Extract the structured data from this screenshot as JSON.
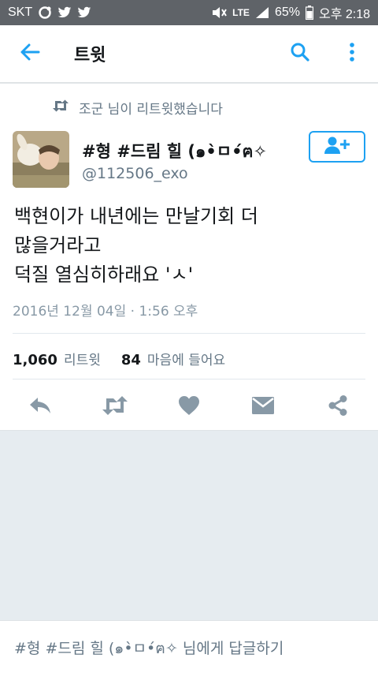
{
  "status_bar": {
    "carrier": "SKT",
    "network": "LTE",
    "battery": "65%",
    "time": "오후 2:18",
    "icons": [
      "target-icon",
      "twitter-bird-icon",
      "twitter-bird-icon",
      "mute-icon",
      "signal-icon",
      "battery-icon"
    ]
  },
  "app_bar": {
    "title": "트윗",
    "icons": [
      "back-arrow-icon",
      "search-icon",
      "more-vertical-icon"
    ]
  },
  "tweet": {
    "retweet_context": "조군 님이 리트윗했습니다",
    "author_name": "#형 #드림 힐 (๑•̀ㅁ•́ฅ✧",
    "author_handle": "@112506_exo",
    "text": "백현이가 내년에는 만날기회 더\n많을거라고\n덕질 열심히하래요 'ㅅ'",
    "timestamp": "2016년 12월 04일 · 1:56 오후",
    "retweets_count": "1,060",
    "retweets_label": "리트윗",
    "likes_count": "84",
    "likes_label": "마음에 들어요",
    "follow_icon": "add-user-icon",
    "action_icons": [
      "reply-icon",
      "retweet-icon",
      "like-heart-icon",
      "message-icon",
      "share-icon"
    ]
  },
  "reply_bar": {
    "placeholder": "#형 #드림 힐 (๑•̀ㅁ•́ฅ✧ 님에게 답글하기"
  },
  "colors": {
    "accent": "#1da1f2",
    "secondary_text": "#657786",
    "action_icon": "#8899a6",
    "status_bar_bg": "#5f6368",
    "background": "#e6ecf0"
  }
}
